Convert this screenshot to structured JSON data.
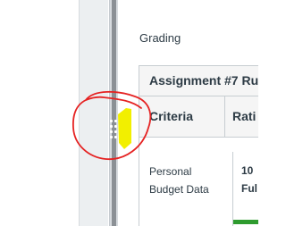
{
  "page": {
    "section_title": "Grading"
  },
  "rubric": {
    "title": "Assignment #7 Ru",
    "headers": {
      "criteria": "Criteria",
      "ratings": "Rati"
    },
    "rows": [
      {
        "criterion": "Personal Budget Data",
        "rating_points": "10",
        "rating_description": "Ful"
      }
    ]
  },
  "annotation": {
    "circle_color": "#e52222",
    "highlight_color": "#f2ef00"
  },
  "colors": {
    "text": "#2d3b45",
    "border": "#c7cdd1",
    "rating_bar": "#2e9b2e"
  }
}
